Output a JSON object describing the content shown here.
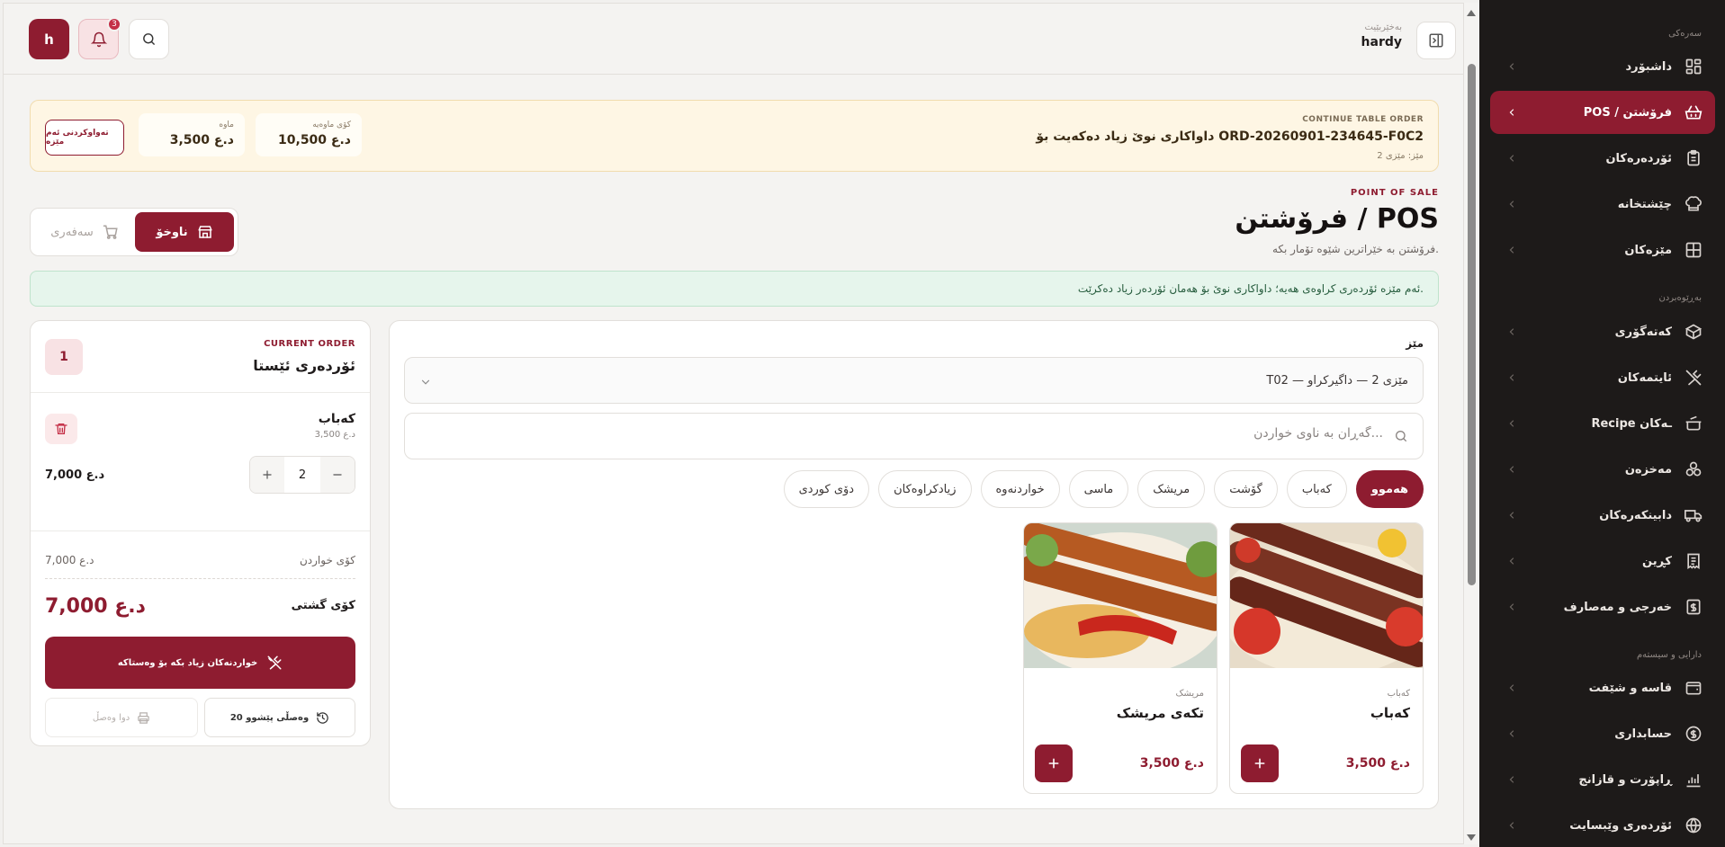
{
  "topbar": {
    "avatar_letter": "h",
    "notification_count": "3",
    "user_label": "بەخێربێیت",
    "user_name": "hardy"
  },
  "sidebar": {
    "section_main": "سەرەکی",
    "section_manage": "بەڕێوەبردن",
    "section_finance": "دارایی و سیستەم",
    "items_main": [
      {
        "label": "داشبۆرد",
        "icon": "dashboard-icon",
        "active": false
      },
      {
        "label": "POS / فرۆشتن",
        "icon": "basket-icon",
        "active": true
      },
      {
        "label": "ئۆردەرەکان",
        "icon": "clipboard-icon",
        "active": false
      },
      {
        "label": "چێشتخانە",
        "icon": "chef-hat-icon",
        "active": false
      },
      {
        "label": "مێزەکان",
        "icon": "table-grid-icon",
        "active": false
      }
    ],
    "items_manage": [
      {
        "label": "کەتەگۆری",
        "icon": "box-icon"
      },
      {
        "label": "ئایتمەکان",
        "icon": "utensils-icon"
      },
      {
        "label": "Recipe ـەکان",
        "icon": "cooking-pot-icon"
      },
      {
        "label": "مەخزەن",
        "icon": "boxes-icon"
      },
      {
        "label": "دابینکەرەکان",
        "icon": "truck-icon"
      },
      {
        "label": "کڕین",
        "icon": "receipt-icon"
      },
      {
        "label": "خەرجی و مەصارف",
        "icon": "bill-icon"
      }
    ],
    "items_finance": [
      {
        "label": "قاسە و شێفت",
        "icon": "wallet-icon"
      },
      {
        "label": "حسابداری",
        "icon": "coin-icon"
      },
      {
        "label": "ڕاپۆرت و قازانج",
        "icon": "chart-icon"
      },
      {
        "label": "ئۆردەری وێبسایت",
        "icon": "globe-icon"
      }
    ]
  },
  "order_banner": {
    "tag": "CONTINUE TABLE ORDER",
    "title": "داواکاری نوێ زیاد دەکەیت بۆ ORD-20260901-234645-F0C2",
    "subtitle": "مێز: مێزی 2",
    "card_total_label": "کۆی ماوەیە",
    "card_total_value": "10,500 د.ع",
    "card_paid_label": "ماوە",
    "card_paid_value": "3,500 د.ع",
    "finish_label": "تەواوکردنی ئەم مێزە"
  },
  "header": {
    "tag": "POINT OF SALE",
    "title": "فرۆشتن / POS",
    "subtitle": "فرۆشتن بە خێراترین شێوە تۆمار بکە."
  },
  "mode": {
    "local_label": "ناوخۆ",
    "travel_label": "سەفەری"
  },
  "info_banner": "ئەم مێزە ئۆردەری کراوەی هەیە؛ داواکاری نوێ بۆ هەمان ئۆردەر زیاد دەکرێت.",
  "products": {
    "table_label": "مێز",
    "table_value": "T02 — مێزی 2 — داگیرکراو",
    "search_placeholder": "گەڕان بە ناوی خواردن...",
    "categories": [
      {
        "label": "هەموو",
        "active": true
      },
      {
        "label": "کەباب",
        "active": false
      },
      {
        "label": "گۆشت",
        "active": false
      },
      {
        "label": "مریشک",
        "active": false
      },
      {
        "label": "ماسی",
        "active": false
      },
      {
        "label": "خواردنەوە",
        "active": false
      },
      {
        "label": "زیادکراوەکان",
        "active": false
      },
      {
        "label": "دۆی کوردی",
        "active": false
      }
    ],
    "items": [
      {
        "category": "کەباب",
        "name": "کەباب",
        "price": "3,500 د.ع"
      },
      {
        "category": "مریشک",
        "name": "تکەی مریشک",
        "price": "3,500 د.ع"
      }
    ]
  },
  "cart": {
    "tag": "CURRENT ORDER",
    "title": "ئۆردەری ئێستا",
    "count": "1",
    "line": {
      "name": "کەباب",
      "unit_price": "3,500 د.ع",
      "qty": "2",
      "total": "7,000 د.ع"
    },
    "subtotal_label": "کۆی خواردن",
    "subtotal_value": "7,000 د.ع",
    "total_label": "کۆی گشتی",
    "total_value": "7,000 د.ع",
    "add_kitchen_label": "خواردنەکان زیاد بکە بۆ وەستاکە",
    "history_label": "20 وەصڵی پێشوو",
    "print_label": "دوا وەصڵ"
  }
}
